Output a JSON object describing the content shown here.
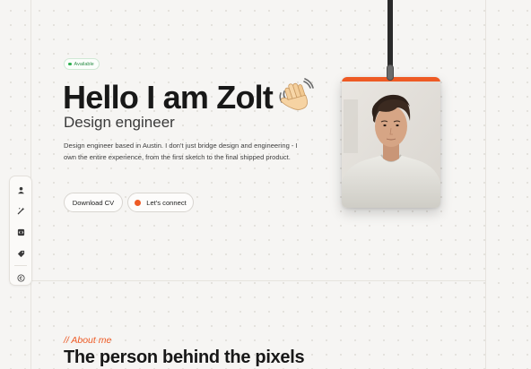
{
  "hero": {
    "badge": "Available",
    "title": "Hello I am Zolt",
    "title_emoji": "waving-hand",
    "role": "Design engineer",
    "bio": "Design engineer based in Austin. I don't just bridge design and engineering - I own the entire experience, from the first sketch to the final shipped product.",
    "download_label": "Download CV",
    "connect_label": "Let's connect"
  },
  "toolbar": {
    "items": [
      "user-icon",
      "magic-wand-icon",
      "code-icon",
      "tag-icon",
      "copyright-icon"
    ]
  },
  "about": {
    "kicker": "// About me",
    "title": "The person behind the pixels"
  },
  "colors": {
    "accent": "#ee5a24",
    "available": "#2fb04f",
    "background": "#f6f5f3"
  }
}
